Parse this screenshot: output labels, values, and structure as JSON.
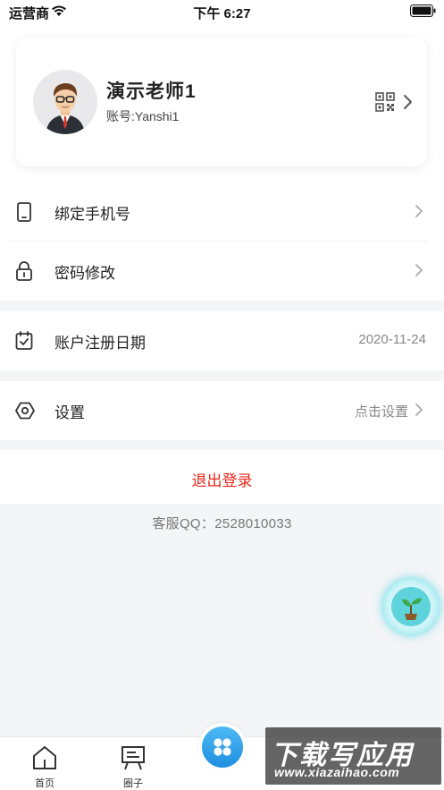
{
  "status_bar": {
    "carrier": "运营商",
    "time": "下午 6:27"
  },
  "profile": {
    "name": "演示老师1",
    "account": "账号:Yanshi1"
  },
  "menu": {
    "bind_phone": "绑定手机号",
    "change_password": "密码修改",
    "register_date_label": "账户注册日期",
    "register_date_value": "2020-11-24",
    "settings_label": "设置",
    "settings_hint": "点击设置"
  },
  "logout_label": "退出登录",
  "service_text": "客服QQ：2528010033",
  "tabbar": {
    "home": "首页",
    "circle": "圈子"
  },
  "watermark": {
    "main": "下载写应用",
    "sub": "www.xiazaihao.com"
  },
  "colors": {
    "logout": "#e8271b",
    "accent_blue": "#1e8fe0",
    "float_teal": "#5fd3dc"
  }
}
